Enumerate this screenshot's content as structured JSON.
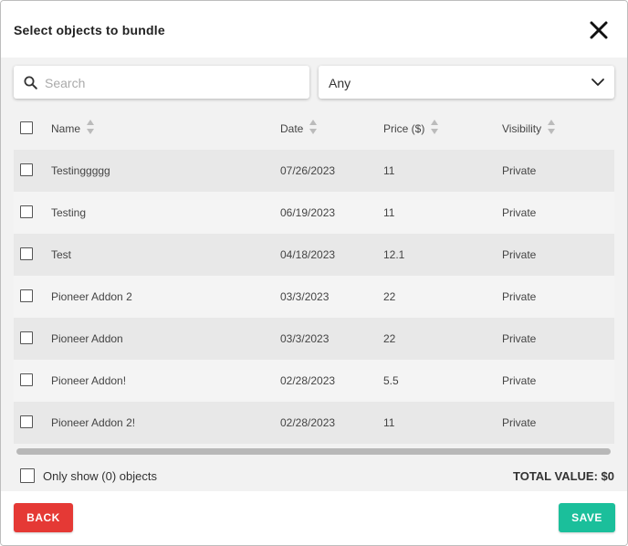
{
  "dialog": {
    "title": "Select objects to bundle"
  },
  "search": {
    "placeholder": "Search",
    "value": ""
  },
  "filter": {
    "selected": "Any"
  },
  "table": {
    "headers": {
      "name": "Name",
      "date": "Date",
      "price": "Price ($)",
      "visibility": "Visibility"
    },
    "rows": [
      {
        "name": "Testinggggg",
        "date": "07/26/2023",
        "price": "11",
        "visibility": "Private"
      },
      {
        "name": "Testing",
        "date": "06/19/2023",
        "price": "11",
        "visibility": "Private"
      },
      {
        "name": "Test",
        "date": "04/18/2023",
        "price": "12.1",
        "visibility": "Private"
      },
      {
        "name": "Pioneer Addon 2",
        "date": "03/3/2023",
        "price": "22",
        "visibility": "Private"
      },
      {
        "name": "Pioneer Addon",
        "date": "03/3/2023",
        "price": "22",
        "visibility": "Private"
      },
      {
        "name": "Pioneer Addon!",
        "date": "02/28/2023",
        "price": "5.5",
        "visibility": "Private"
      },
      {
        "name": "Pioneer Addon 2!",
        "date": "02/28/2023",
        "price": "11",
        "visibility": "Private"
      }
    ]
  },
  "footer_bar": {
    "only_show_label": "Only show (0) objects",
    "total_value": "TOTAL VALUE: $0"
  },
  "buttons": {
    "back": "BACK",
    "save": "SAVE"
  },
  "colors": {
    "back": "#e53935",
    "save": "#1bbf9b"
  },
  "icons": {
    "close": "close-icon",
    "search": "search-icon",
    "dropdown": "chevron-down-icon",
    "sort": "sort-icon"
  }
}
